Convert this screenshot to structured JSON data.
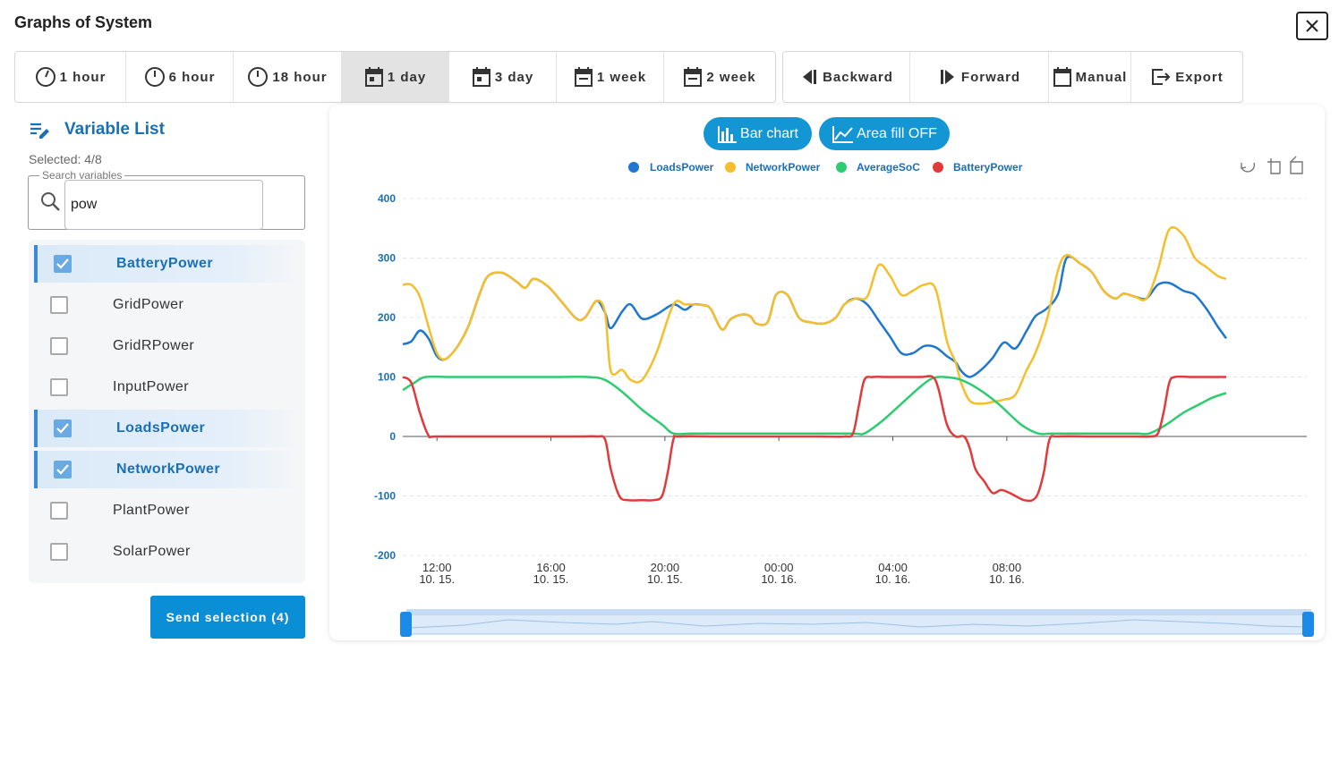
{
  "window": {
    "title": "Graphs of System"
  },
  "time_ranges": [
    {
      "label": "1 hour",
      "icon": "clock-icon"
    },
    {
      "label": "6 hour",
      "icon": "clock-icon"
    },
    {
      "label": "18 hour",
      "icon": "clock-icon"
    },
    {
      "label": "1 day",
      "icon": "calendar-icon",
      "active": true
    },
    {
      "label": "3 day",
      "icon": "calendar-icon"
    },
    {
      "label": "1 week",
      "icon": "calendar-icon"
    },
    {
      "label": "2 week",
      "icon": "calendar-icon"
    }
  ],
  "nav": {
    "backward": "Backward",
    "forward": "Forward",
    "manual": "Manual",
    "export": "Export"
  },
  "variable_list": {
    "title": "Variable List",
    "selected": "Selected: 4/8",
    "search_label": "Search variables",
    "search_value": "pow",
    "items": [
      {
        "label": "BatteryPower",
        "checked": true
      },
      {
        "label": "GridPower",
        "checked": false
      },
      {
        "label": "GridRPower",
        "checked": false
      },
      {
        "label": "InputPower",
        "checked": false
      },
      {
        "label": "LoadsPower",
        "checked": true
      },
      {
        "label": "NetworkPower",
        "checked": true
      },
      {
        "label": "PlantPower",
        "checked": false
      },
      {
        "label": "SolarPower",
        "checked": false
      }
    ],
    "send_label": "Send selection (4)"
  },
  "chart_controls": {
    "bar_chart": "Bar chart",
    "area_fill": "Area fill OFF"
  },
  "colors": {
    "accent": "#1496d4",
    "LoadsPower": "#1f77d0",
    "NetworkPower": "#f5bf2c",
    "AverageSoC": "#2ecc71",
    "BatteryPower": "#e03a3a"
  },
  "chart_data": {
    "type": "line",
    "ylim": [
      -200,
      400
    ],
    "yticks": [
      "400",
      "300",
      "200",
      "100",
      "0",
      "-100",
      "-200"
    ],
    "xlim_hours": [
      10.8,
      34.7
    ],
    "xticks": [
      {
        "time": "12:00",
        "date": "10. 15.",
        "h": 12
      },
      {
        "time": "16:00",
        "date": "10. 15.",
        "h": 16
      },
      {
        "time": "20:00",
        "date": "10. 15.",
        "h": 20
      },
      {
        "time": "00:00",
        "date": "10. 16.",
        "h": 24
      },
      {
        "time": "04:00",
        "date": "10. 16.",
        "h": 28
      },
      {
        "time": "08:00",
        "date": "10. 16.",
        "h": 32
      }
    ],
    "series": [
      {
        "name": "LoadsPower",
        "color": "#1f77d0",
        "points": [
          [
            10.8,
            155
          ],
          [
            11.1,
            160
          ],
          [
            11.4,
            178
          ],
          [
            11.7,
            165
          ],
          [
            12.0,
            135
          ],
          [
            12.3,
            130
          ],
          [
            12.7,
            150
          ],
          [
            13.1,
            185
          ],
          [
            13.5,
            240
          ],
          [
            13.8,
            270
          ],
          [
            14.3,
            275
          ],
          [
            14.8,
            260
          ],
          [
            15.1,
            250
          ],
          [
            15.4,
            265
          ],
          [
            15.9,
            252
          ],
          [
            16.4,
            225
          ],
          [
            16.9,
            198
          ],
          [
            17.2,
            200
          ],
          [
            17.6,
            228
          ],
          [
            17.9,
            208
          ],
          [
            18.1,
            182
          ],
          [
            18.5,
            210
          ],
          [
            18.8,
            222
          ],
          [
            19.2,
            198
          ],
          [
            19.7,
            205
          ],
          [
            20.3,
            222
          ],
          [
            20.7,
            213
          ],
          [
            21.0,
            222
          ],
          [
            21.3,
            221
          ],
          [
            21.6,
            215
          ],
          [
            22.0,
            180
          ],
          [
            22.3,
            197
          ],
          [
            22.7,
            205
          ],
          [
            23.0,
            202
          ],
          [
            23.2,
            190
          ],
          [
            23.6,
            192
          ],
          [
            23.9,
            238
          ],
          [
            24.3,
            238
          ],
          [
            24.7,
            200
          ],
          [
            25.1,
            192
          ],
          [
            25.6,
            190
          ],
          [
            26.0,
            200
          ],
          [
            26.3,
            222
          ],
          [
            26.7,
            232
          ],
          [
            27.1,
            222
          ],
          [
            27.5,
            195
          ],
          [
            27.9,
            168
          ],
          [
            28.3,
            140
          ],
          [
            28.7,
            140
          ],
          [
            29.1,
            152
          ],
          [
            29.5,
            150
          ],
          [
            29.9,
            135
          ],
          [
            30.2,
            125
          ],
          [
            30.4,
            110
          ],
          [
            30.7,
            100
          ],
          [
            31.1,
            112
          ],
          [
            31.5,
            132
          ],
          [
            31.9,
            158
          ],
          [
            32.3,
            148
          ],
          [
            32.7,
            178
          ],
          [
            33.0,
            202
          ],
          [
            33.4,
            215
          ],
          [
            33.8,
            240
          ],
          [
            34.1,
            300
          ],
          [
            34.6,
            290
          ],
          [
            35.0,
            275
          ],
          [
            35.4,
            245
          ],
          [
            35.8,
            232
          ],
          [
            36.1,
            240
          ],
          [
            36.5,
            235
          ],
          [
            36.9,
            232
          ],
          [
            37.3,
            255
          ],
          [
            37.7,
            258
          ],
          [
            38.2,
            245
          ],
          [
            38.6,
            238
          ],
          [
            39.0,
            215
          ],
          [
            39.4,
            185
          ],
          [
            39.7,
            165
          ]
        ]
      },
      {
        "name": "NetworkPower",
        "color": "#f5bf2c",
        "points": [
          [
            10.8,
            255
          ],
          [
            11.1,
            255
          ],
          [
            11.4,
            235
          ],
          [
            11.7,
            185
          ],
          [
            12.0,
            140
          ],
          [
            12.3,
            130
          ],
          [
            12.7,
            150
          ],
          [
            13.1,
            185
          ],
          [
            13.5,
            240
          ],
          [
            13.8,
            270
          ],
          [
            14.3,
            275
          ],
          [
            14.8,
            260
          ],
          [
            15.1,
            250
          ],
          [
            15.4,
            265
          ],
          [
            15.9,
            252
          ],
          [
            16.4,
            225
          ],
          [
            16.9,
            198
          ],
          [
            17.2,
            200
          ],
          [
            17.6,
            228
          ],
          [
            17.9,
            208
          ],
          [
            18.1,
            110
          ],
          [
            18.5,
            112
          ],
          [
            18.8,
            95
          ],
          [
            19.2,
            95
          ],
          [
            19.7,
            140
          ],
          [
            20.3,
            222
          ],
          [
            20.7,
            222
          ],
          [
            21.0,
            222
          ],
          [
            21.3,
            221
          ],
          [
            21.6,
            215
          ],
          [
            22.0,
            180
          ],
          [
            22.3,
            197
          ],
          [
            22.7,
            205
          ],
          [
            23.0,
            202
          ],
          [
            23.2,
            190
          ],
          [
            23.6,
            192
          ],
          [
            23.9,
            238
          ],
          [
            24.3,
            238
          ],
          [
            24.7,
            200
          ],
          [
            25.1,
            192
          ],
          [
            25.6,
            190
          ],
          [
            26.0,
            200
          ],
          [
            26.3,
            222
          ],
          [
            26.7,
            232
          ],
          [
            27.1,
            235
          ],
          [
            27.5,
            288
          ],
          [
            27.9,
            270
          ],
          [
            28.3,
            238
          ],
          [
            28.7,
            245
          ],
          [
            29.1,
            255
          ],
          [
            29.5,
            248
          ],
          [
            29.9,
            160
          ],
          [
            30.2,
            125
          ],
          [
            30.4,
            90
          ],
          [
            30.7,
            60
          ],
          [
            31.1,
            55
          ],
          [
            31.5,
            58
          ],
          [
            31.9,
            62
          ],
          [
            32.3,
            70
          ],
          [
            32.7,
            112
          ],
          [
            33.0,
            140
          ],
          [
            33.4,
            195
          ],
          [
            33.8,
            280
          ],
          [
            34.1,
            305
          ],
          [
            34.6,
            290
          ],
          [
            35.0,
            275
          ],
          [
            35.4,
            245
          ],
          [
            35.8,
            232
          ],
          [
            36.1,
            240
          ],
          [
            36.5,
            235
          ],
          [
            36.9,
            232
          ],
          [
            37.3,
            280
          ],
          [
            37.7,
            348
          ],
          [
            38.2,
            338
          ],
          [
            38.6,
            300
          ],
          [
            39.0,
            285
          ],
          [
            39.4,
            270
          ],
          [
            39.7,
            265
          ]
        ]
      },
      {
        "name": "AverageSoC",
        "color": "#2ecc71",
        "points": [
          [
            10.8,
            78
          ],
          [
            11.2,
            90
          ],
          [
            11.6,
            100
          ],
          [
            12.5,
            100
          ],
          [
            14.0,
            100
          ],
          [
            16.0,
            100
          ],
          [
            17.3,
            100
          ],
          [
            17.9,
            95
          ],
          [
            18.5,
            75
          ],
          [
            19.2,
            45
          ],
          [
            19.9,
            20
          ],
          [
            20.3,
            5
          ],
          [
            21.0,
            5
          ],
          [
            23.0,
            5
          ],
          [
            25.0,
            5
          ],
          [
            26.6,
            5
          ],
          [
            27.0,
            5
          ],
          [
            27.6,
            25
          ],
          [
            28.3,
            55
          ],
          [
            29.0,
            85
          ],
          [
            29.4,
            98
          ],
          [
            29.8,
            100
          ],
          [
            30.4,
            95
          ],
          [
            31.0,
            80
          ],
          [
            31.7,
            55
          ],
          [
            32.5,
            20
          ],
          [
            33.1,
            5
          ],
          [
            33.6,
            5
          ],
          [
            35.0,
            5
          ],
          [
            36.0,
            5
          ],
          [
            36.6,
            5
          ],
          [
            37.0,
            5
          ],
          [
            37.6,
            20
          ],
          [
            38.2,
            40
          ],
          [
            38.8,
            55
          ],
          [
            39.2,
            65
          ],
          [
            39.7,
            73
          ]
        ]
      },
      {
        "name": "BatteryPower",
        "color": "#e03a3a",
        "points": [
          [
            10.8,
            100
          ],
          [
            11.1,
            90
          ],
          [
            11.4,
            40
          ],
          [
            11.7,
            2
          ],
          [
            12.0,
            0
          ],
          [
            14.0,
            0
          ],
          [
            16.0,
            0
          ],
          [
            17.0,
            0
          ],
          [
            17.6,
            0
          ],
          [
            17.9,
            -5
          ],
          [
            18.1,
            -55
          ],
          [
            18.4,
            -100
          ],
          [
            18.7,
            -107
          ],
          [
            19.2,
            -107
          ],
          [
            19.6,
            -107
          ],
          [
            19.9,
            -100
          ],
          [
            20.1,
            -60
          ],
          [
            20.3,
            -5
          ],
          [
            20.5,
            0
          ],
          [
            22.0,
            0
          ],
          [
            24.0,
            0
          ],
          [
            25.5,
            0
          ],
          [
            26.3,
            0
          ],
          [
            26.6,
            5
          ],
          [
            26.8,
            50
          ],
          [
            27.0,
            95
          ],
          [
            27.3,
            100
          ],
          [
            27.8,
            100
          ],
          [
            28.5,
            100
          ],
          [
            29.0,
            100
          ],
          [
            29.4,
            100
          ],
          [
            29.6,
            80
          ],
          [
            29.9,
            20
          ],
          [
            30.2,
            0
          ],
          [
            30.5,
            0
          ],
          [
            30.7,
            -20
          ],
          [
            30.9,
            -55
          ],
          [
            31.2,
            -75
          ],
          [
            31.5,
            -95
          ],
          [
            31.8,
            -90
          ],
          [
            32.1,
            -95
          ],
          [
            32.3,
            -100
          ],
          [
            32.6,
            -107
          ],
          [
            32.9,
            -107
          ],
          [
            33.1,
            -95
          ],
          [
            33.3,
            -60
          ],
          [
            33.5,
            -5
          ],
          [
            33.8,
            0
          ],
          [
            35.0,
            0
          ],
          [
            36.5,
            0
          ],
          [
            37.0,
            0
          ],
          [
            37.3,
            5
          ],
          [
            37.5,
            40
          ],
          [
            37.7,
            90
          ],
          [
            37.9,
            100
          ],
          [
            38.5,
            100
          ],
          [
            39.2,
            100
          ],
          [
            39.7,
            100
          ]
        ]
      }
    ]
  }
}
